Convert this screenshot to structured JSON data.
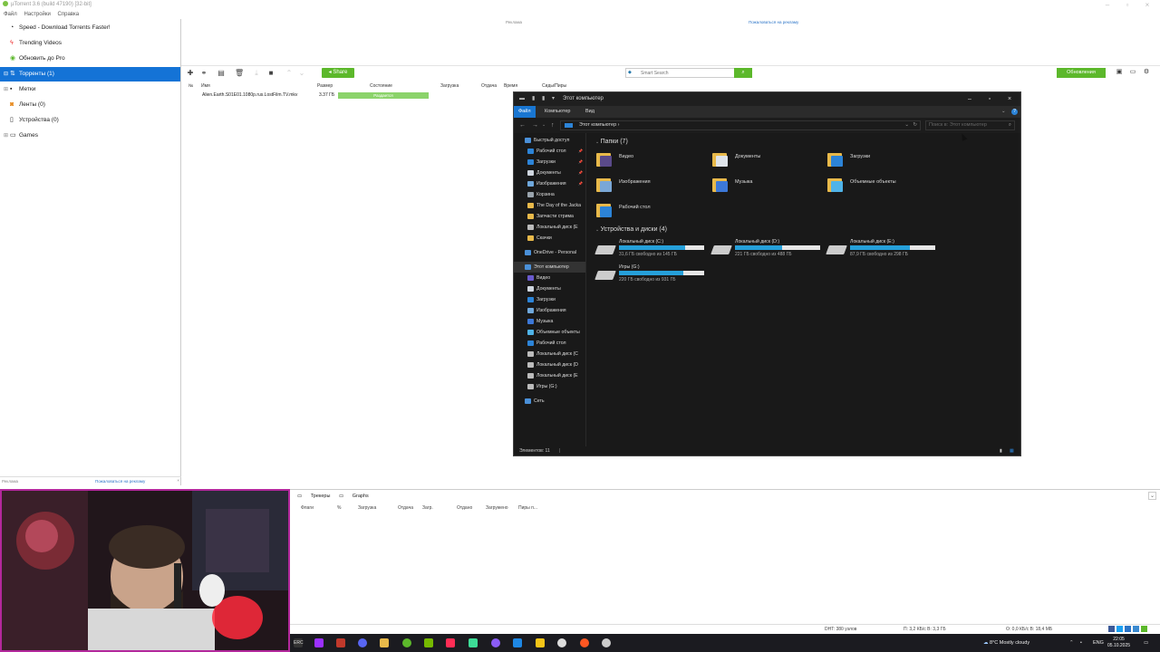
{
  "window": {
    "title": "µTorrent 3.6 (build 47190) [32-bit]"
  },
  "menu": [
    "Файл",
    "Настройки",
    "Справка"
  ],
  "sidebar": {
    "items": [
      {
        "label": "Speed - Download Torrents Faster!",
        "icon": "speed-icon"
      },
      {
        "label": "Trending Videos",
        "icon": "fire-icon"
      },
      {
        "label": "Обновить до Pro",
        "icon": "pro-icon"
      },
      {
        "label": "Торренты (1)",
        "icon": "torrents-icon",
        "active": true
      },
      {
        "label": "Метки",
        "icon": "labels-icon"
      },
      {
        "label": "Ленты (0)",
        "icon": "feeds-icon"
      },
      {
        "label": "Устройства (0)",
        "icon": "devices-icon"
      },
      {
        "label": "Games",
        "icon": "games-icon"
      }
    ],
    "ad_left": "Реклама",
    "ad_right": "Пожаловаться на рекламу"
  },
  "top_ad": {
    "left": "Реклама",
    "right": "Пожаловаться на рекламу"
  },
  "toolbar": {
    "share_label": "Share",
    "search_placeholder": "Smart Search",
    "update_label": "Обновления"
  },
  "torrent_table": {
    "headers": [
      "№",
      "Имя",
      "Размер",
      "Состояние",
      "Загрузка",
      "Отдача",
      "Время",
      "Сиды/Пиры"
    ],
    "rows": [
      {
        "name": "Alien.Earth.S01E01.1080p.rus.LostFilm.TV.mkv",
        "size": "3.37 ГБ",
        "status": "Раздается"
      }
    ]
  },
  "explorer": {
    "title": "Этот компьютер",
    "ribbon_tabs": [
      "Файл",
      "Компьютер",
      "Вид"
    ],
    "address": "Этот компьютер",
    "search_placeholder": "Поиск в: Этот компьютер",
    "nav": [
      {
        "label": "Быстрый доступ",
        "color": "#4a90d9"
      },
      {
        "label": "Рабочий стол",
        "color": "#2c84d8",
        "pin": true
      },
      {
        "label": "Загрузки",
        "color": "#2c84d8",
        "pin": true
      },
      {
        "label": "Документы",
        "color": "#cfd6df",
        "pin": true
      },
      {
        "label": "Изображения",
        "color": "#6fa8dc",
        "pin": true
      },
      {
        "label": "Корзина",
        "color": "#9aa4ad"
      },
      {
        "label": "The Day of the Jacka",
        "color": "#e8b94a"
      },
      {
        "label": "Запчасти стрима",
        "color": "#e8b94a"
      },
      {
        "label": "Локальный диск (E",
        "color": "#bbbbbb"
      },
      {
        "label": "Скачки",
        "color": "#e8b94a"
      },
      {
        "label": "OneDrive - Personal",
        "color": "#4a90d9"
      },
      {
        "label": "Этот компьютер",
        "color": "#4a90d9"
      },
      {
        "label": "Видео",
        "color": "#6a5acd"
      },
      {
        "label": "Документы",
        "color": "#cfd6df"
      },
      {
        "label": "Загрузки",
        "color": "#2c84d8"
      },
      {
        "label": "Изображения",
        "color": "#6fa8dc"
      },
      {
        "label": "Музыка",
        "color": "#3c78d8"
      },
      {
        "label": "Объемные объекты",
        "color": "#4fb3e8"
      },
      {
        "label": "Рабочий стол",
        "color": "#2c84d8"
      },
      {
        "label": "Локальный диск (C",
        "color": "#bbbbbb"
      },
      {
        "label": "Локальный диск (D",
        "color": "#bbbbbb"
      },
      {
        "label": "Локальный диск (E",
        "color": "#bbbbbb"
      },
      {
        "label": "Игры (G:)",
        "color": "#bbbbbb"
      },
      {
        "label": "Сеть",
        "color": "#4a90d9"
      }
    ],
    "folders_title": "Папки (7)",
    "folders": [
      {
        "label": "Видео",
        "overlay": "#5a4a8a"
      },
      {
        "label": "Документы",
        "overlay": "#dfe4ea"
      },
      {
        "label": "Загрузки",
        "overlay": "#2c84d8"
      },
      {
        "label": "Изображения",
        "overlay": "#7aa7d6"
      },
      {
        "label": "Музыка",
        "overlay": "#3c78d8"
      },
      {
        "label": "Объемные объекты",
        "overlay": "#4fb3e8"
      },
      {
        "label": "Рабочий стол",
        "overlay": "#2c84d8"
      }
    ],
    "drives_title": "Устройства и диски (4)",
    "drives": [
      {
        "name": "Локальный диск (C:)",
        "free": "31,6 ГБ свободно из 145 ГБ",
        "used_fraction": 0.78
      },
      {
        "name": "Локальный диск (D:)",
        "free": "221 ГБ свободно из 488 ГБ",
        "used_fraction": 0.55
      },
      {
        "name": "Локальный диск (E:)",
        "free": "87,9 ГБ свободно из 298 ГБ",
        "used_fraction": 0.7
      },
      {
        "name": "Игры (G:)",
        "free": "220 ГБ свободно из 931 ГБ",
        "used_fraction": 0.76
      }
    ],
    "status": "Элементов: 11"
  },
  "bottom_panel": {
    "tabs": [
      "Трекеры",
      "Graphs"
    ],
    "columns": [
      "Флаги",
      "%",
      "Загрузка",
      "Отдача",
      "Загр.",
      "Отдано",
      "Загружено",
      "Пиры п..."
    ]
  },
  "status_bar": {
    "dht": "DHT: 380 узлов",
    "down": "П: 3,2 КБ/с В: 3,3 ГБ",
    "up": "О: 0,0 КБ/с В: 18,4 МБ"
  },
  "taskbar": {
    "weather": "8°C  Mostly cloudy",
    "lang": "ENG",
    "time": "22:05",
    "date": "05.10.2025"
  }
}
